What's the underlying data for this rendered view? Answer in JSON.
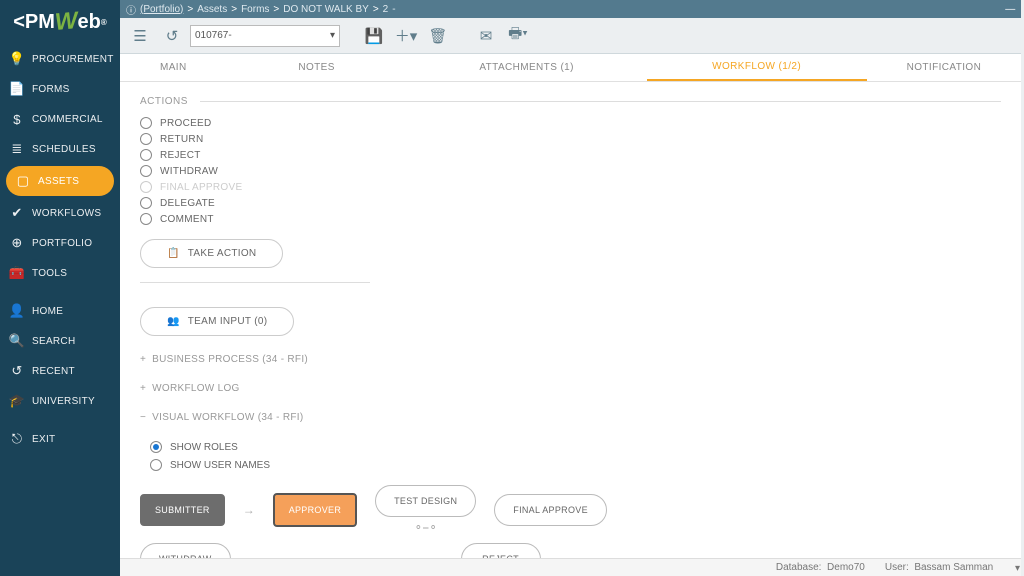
{
  "logo": {
    "p": "PM",
    "w": "W",
    "eb": "eb",
    "reg": "®"
  },
  "breadcrumb": [
    "(Portfolio)",
    "Assets",
    "Forms",
    "DO NOT WALK BY",
    "2",
    "-"
  ],
  "doc_select": "010767-",
  "tabs": {
    "main": "Main",
    "notes": "Notes",
    "attachments": "Attachments (1)",
    "workflow": "Workflow (1/2)",
    "notification": "Notification"
  },
  "sidebar": {
    "items": [
      {
        "icon": "💡",
        "label": "Procurement"
      },
      {
        "icon": "📄",
        "label": "Forms"
      },
      {
        "icon": "$",
        "label": "Commercial"
      },
      {
        "icon": "≣",
        "label": "Schedules"
      },
      {
        "icon": "▢",
        "label": "Assets",
        "active": true
      },
      {
        "icon": "✔",
        "label": "Workflows"
      },
      {
        "icon": "⊕",
        "label": "Portfolio"
      },
      {
        "icon": "🧰",
        "label": "Tools"
      }
    ],
    "items2": [
      {
        "icon": "👤",
        "label": "Home"
      },
      {
        "icon": "🔍",
        "label": "Search"
      },
      {
        "icon": "↺",
        "label": "Recent"
      },
      {
        "icon": "🎓",
        "label": "University"
      }
    ],
    "exit": {
      "icon": "⎋",
      "label": "Exit"
    }
  },
  "actions": {
    "title": "ACTIONS",
    "options": [
      {
        "label": "Proceed"
      },
      {
        "label": "Return"
      },
      {
        "label": "Reject"
      },
      {
        "label": "Withdraw"
      },
      {
        "label": "Final Approve",
        "disabled": true
      },
      {
        "label": "Delegate"
      },
      {
        "label": "Comment"
      }
    ],
    "take_action": "Take Action",
    "team_input": "Team Input (0)"
  },
  "sections": {
    "bp": "Business Process (34 - RFI)",
    "log": "Workflow Log",
    "vw": "Visual Workflow (34 - RFI)",
    "show_roles": "Show Roles",
    "show_users": "Show User Names"
  },
  "workflow_nodes": {
    "submitter": "Submitter",
    "approver": "Approver",
    "test_design": "Test Design",
    "final_approve": "Final Approve",
    "withdraw": "Withdraw",
    "reject": "Reject"
  },
  "status": {
    "db_label": "Database:",
    "db": "Demo70",
    "user_label": "User:",
    "user": "Bassam Samman"
  },
  "chart_data": {
    "type": "diagram",
    "title": "Visual Workflow (34 - RFI)",
    "nodes": [
      {
        "id": "submitter",
        "label": "Submitter",
        "state": "done"
      },
      {
        "id": "approver",
        "label": "Approver",
        "state": "current"
      },
      {
        "id": "test_design",
        "label": "Test Design",
        "state": "pending"
      },
      {
        "id": "final_approve",
        "label": "Final Approve",
        "state": "pending"
      },
      {
        "id": "withdraw",
        "label": "Withdraw",
        "state": "alt"
      },
      {
        "id": "reject",
        "label": "Reject",
        "state": "alt"
      }
    ],
    "edges": [
      [
        "submitter",
        "approver"
      ],
      [
        "approver",
        "test_design"
      ],
      [
        "test_design",
        "final_approve"
      ]
    ]
  }
}
